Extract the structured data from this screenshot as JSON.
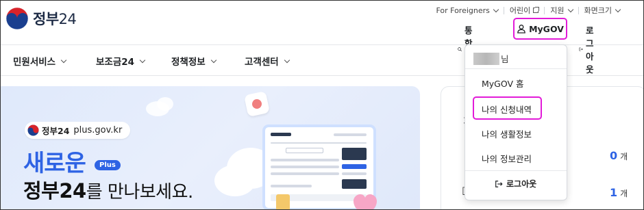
{
  "header": {
    "logo_text": "정부",
    "logo_num": "24",
    "util": [
      {
        "label": "For Foreigners",
        "icon": "chevron-down-icon"
      },
      {
        "label": "어린이",
        "icon": "external-link-icon"
      },
      {
        "label": "지원",
        "icon": "chevron-down-icon"
      },
      {
        "label": "화면크기",
        "icon": "chevron-down-icon"
      }
    ],
    "search_label": "통합검색",
    "mygov_label": "MyGOV",
    "logout_label": "로그아웃"
  },
  "gnb": [
    "민원서비스",
    "보조금24",
    "정책정보",
    "고객센터"
  ],
  "banner": {
    "badge_name": "정부24",
    "badge_url": "plus.gov.kr",
    "headline1": "새로운",
    "plus_pill": "Plus",
    "headline2_bold": "정부24",
    "headline2_rest": "를 만나보세요."
  },
  "side_panel": {
    "count1": "0",
    "count2": "1",
    "unit": "개"
  },
  "dropdown": {
    "user_suffix": "님",
    "items": [
      "MyGOV 홈",
      "나의 신청내역",
      "나의 생활정보",
      "나의 정보관리"
    ],
    "logout": "로그아웃"
  },
  "colors": {
    "accent_blue": "#2e63e4",
    "highlight_magenta": "#e21ad8",
    "text_dark": "#1e2124"
  }
}
